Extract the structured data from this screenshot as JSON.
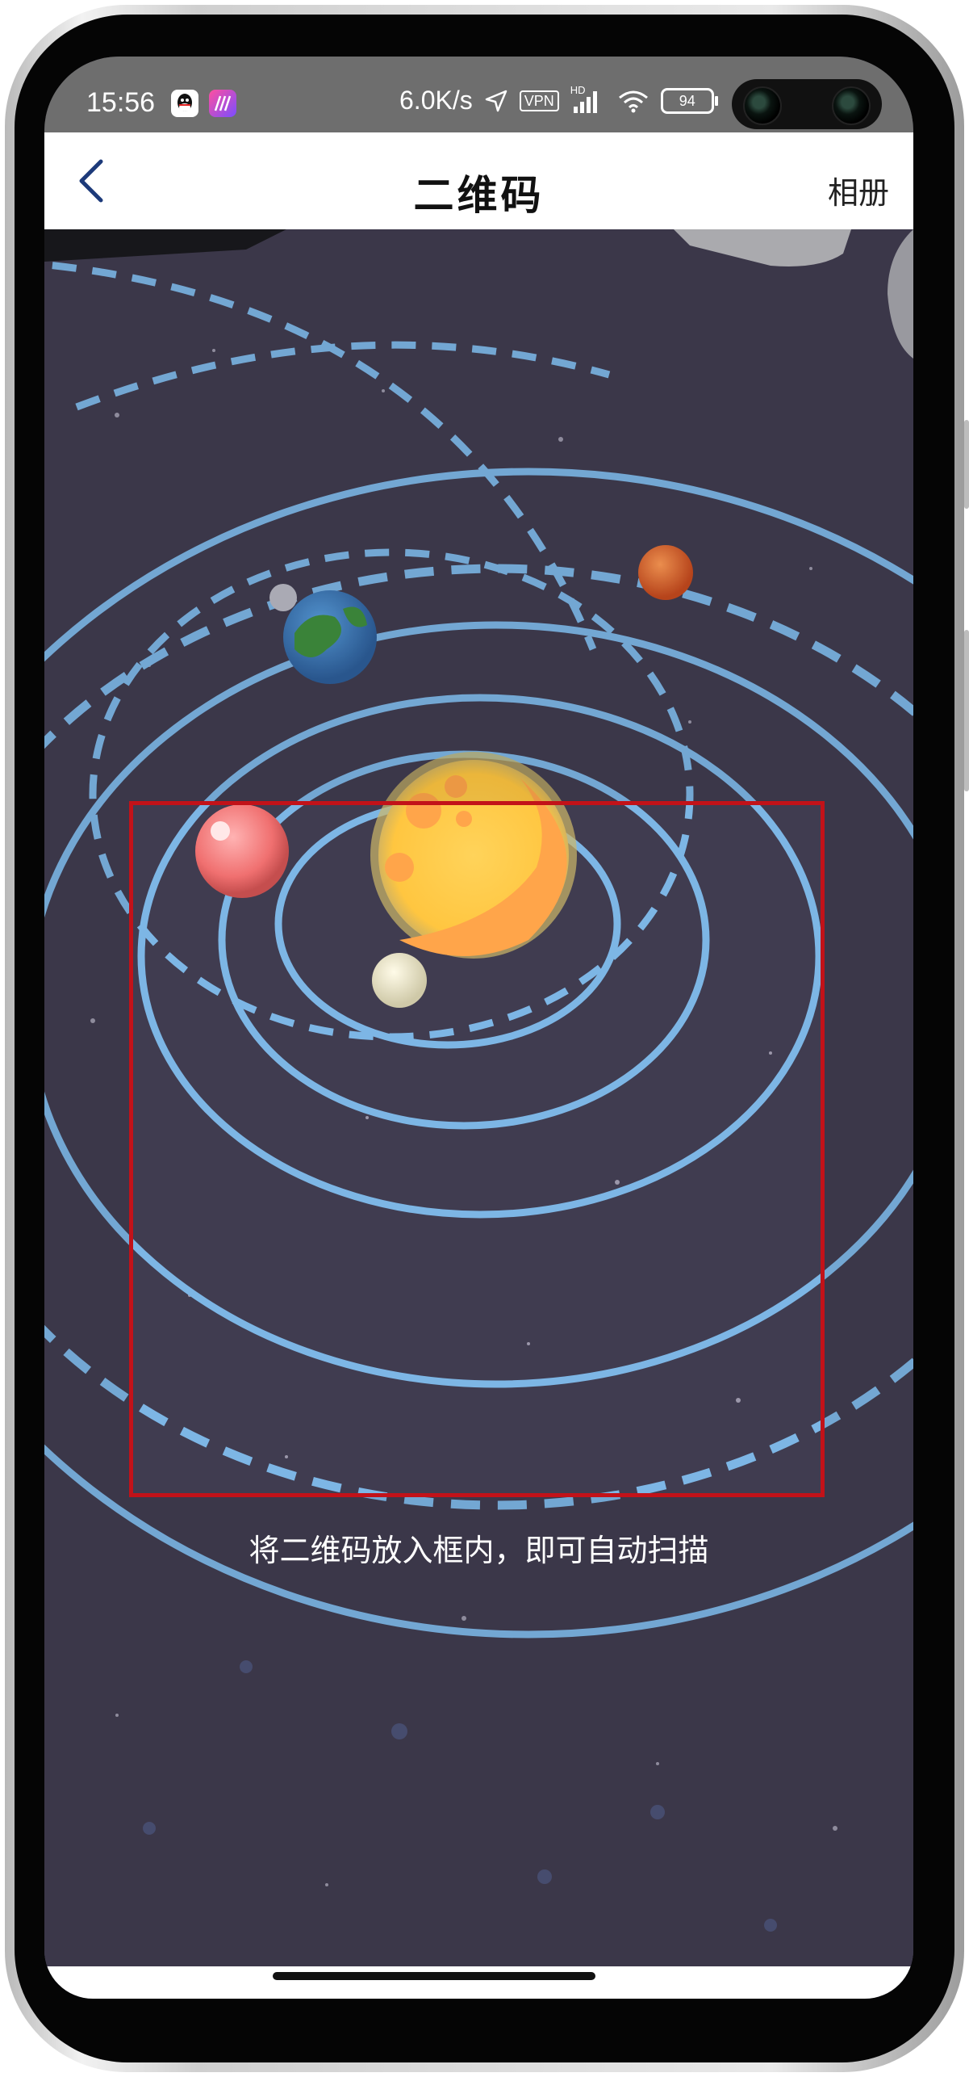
{
  "status_bar": {
    "time": "15:56",
    "network_speed": "6.0K/s",
    "vpn_label": "VPN",
    "hd_label": "HD",
    "battery": "94",
    "icons": [
      "qq-icon",
      "photo-app-icon",
      "location-arrow-icon",
      "signal-icon",
      "wifi-icon",
      "battery-icon"
    ]
  },
  "nav": {
    "title": "二维码",
    "album_label": "相册"
  },
  "scanner": {
    "hint": "将二维码放入框内，即可自动扫描",
    "frame_color": "#c21219"
  },
  "colors": {
    "background_space": "#3f3b4e",
    "orbit": "#79b5e6",
    "status_bar": "#6e6e6e"
  }
}
